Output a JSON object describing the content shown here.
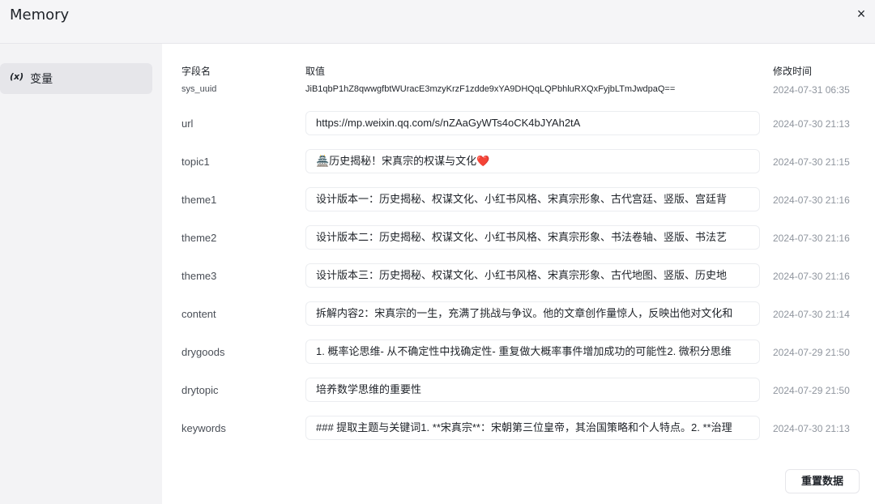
{
  "header": {
    "title": "Memory",
    "close_label": "×"
  },
  "sidebar": {
    "items": [
      {
        "icon_text": "(x)",
        "label": "变量"
      }
    ]
  },
  "table": {
    "headers": {
      "name": "字段名",
      "value": "取值",
      "time": "修改时间"
    },
    "rows": [
      {
        "name": "sys_uuid",
        "value": "JiB1qbP1hZ8qwwgfbtWUracE3mzyKrzF1zdde9xYA9DHQqLQPbhluRXQxFyjbLTmJwdpaQ==",
        "time": "2024-07-31 06:35"
      },
      {
        "name": "url",
        "value": "https://mp.weixin.qq.com/s/nZAaGyWTs4oCK4bJYAh2tA",
        "time": "2024-07-30 21:13"
      },
      {
        "name": "topic1",
        "value": "🏯历史揭秘！宋真宗的权谋与文化❤️",
        "time": "2024-07-30 21:15"
      },
      {
        "name": "theme1",
        "value": "设计版本一：历史揭秘、权谋文化、小红书风格、宋真宗形象、古代宫廷、竖版、宫廷背",
        "time": "2024-07-30 21:16"
      },
      {
        "name": "theme2",
        "value": "设计版本二：历史揭秘、权谋文化、小红书风格、宋真宗形象、书法卷轴、竖版、书法艺",
        "time": "2024-07-30 21:16"
      },
      {
        "name": "theme3",
        "value": "设计版本三：历史揭秘、权谋文化、小红书风格、宋真宗形象、古代地图、竖版、历史地",
        "time": "2024-07-30 21:16"
      },
      {
        "name": "content",
        "value": "拆解内容2：宋真宗的一生，充满了挑战与争议。他的文章创作量惊人，反映出他对文化和",
        "time": "2024-07-30 21:14"
      },
      {
        "name": "drygoods",
        "value": "1. 概率论思维- 从不确定性中找确定性- 重复做大概率事件增加成功的可能性2. 微积分思维",
        "time": "2024-07-29 21:50"
      },
      {
        "name": "drytopic",
        "value": "培养数学思维的重要性",
        "time": "2024-07-29 21:50"
      },
      {
        "name": "keywords",
        "value": "### 提取主题与关键词1. **宋真宗**：宋朝第三位皇帝，其治国策略和个人特点。2. **治理",
        "time": "2024-07-30 21:13"
      }
    ]
  },
  "footer": {
    "reset_label": "重置数据"
  }
}
